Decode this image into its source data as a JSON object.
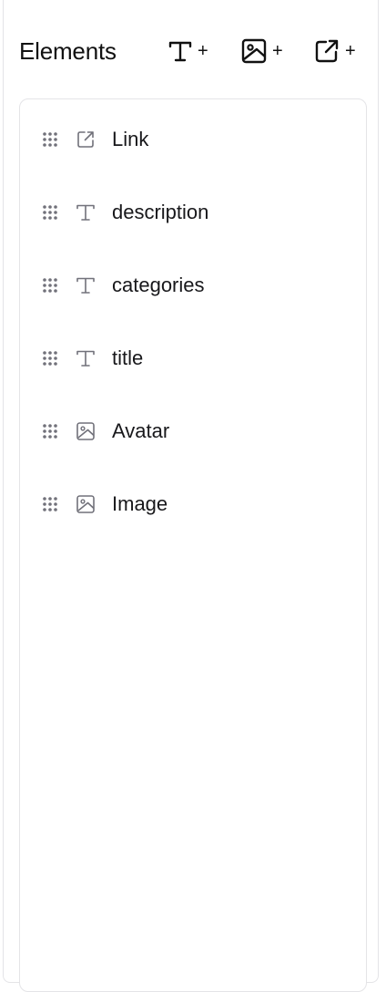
{
  "panel": {
    "title": "Elements",
    "add_buttons": [
      {
        "icon": "text-type-icon",
        "symbol": "+"
      },
      {
        "icon": "image-icon",
        "symbol": "+"
      },
      {
        "icon": "external-link-icon",
        "symbol": "+"
      }
    ]
  },
  "elements": [
    {
      "label": "Link",
      "icon": "external-link-icon"
    },
    {
      "label": "description",
      "icon": "text-type-icon"
    },
    {
      "label": "categories",
      "icon": "text-type-icon"
    },
    {
      "label": "title",
      "icon": "text-type-icon"
    },
    {
      "label": "Avatar",
      "icon": "image-icon"
    },
    {
      "label": "Image",
      "icon": "image-icon"
    }
  ],
  "colors": {
    "border": "#e4e4e7",
    "icon_muted": "#71717a",
    "text": "#18181b"
  }
}
